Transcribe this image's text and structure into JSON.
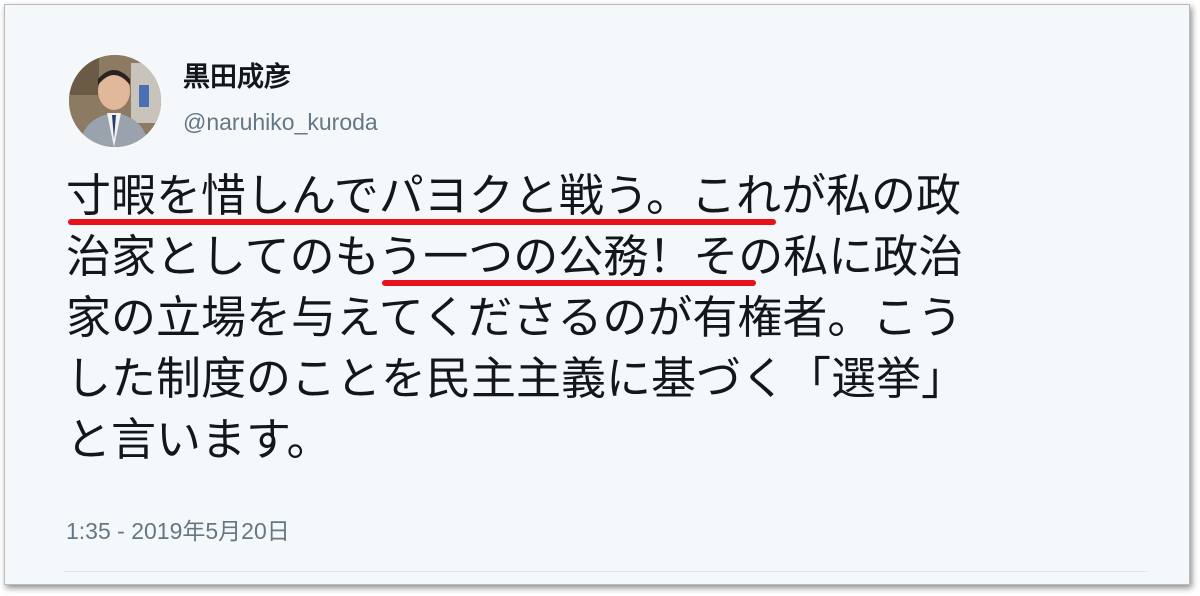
{
  "author": {
    "display_name": "黒田成彦",
    "handle": "@naruhiko_kuroda",
    "avatar_icon": "profile-photo"
  },
  "tweet": {
    "lines": [
      "寸暇を惜しんでパヨクと戦う。これが私の政",
      "治家としてのもう一つの公務！その私に政治",
      "家の立場を与えてくださるのが有権者。こう",
      "した制度のことを民主主義に基づく「選挙」",
      "と言います。"
    ],
    "timestamp": "1:35 - 2019年5月20日"
  },
  "colors": {
    "background": "#f5f8fa",
    "text": "#14171a",
    "muted": "#657786",
    "highlight_underline": "#e8101a"
  }
}
